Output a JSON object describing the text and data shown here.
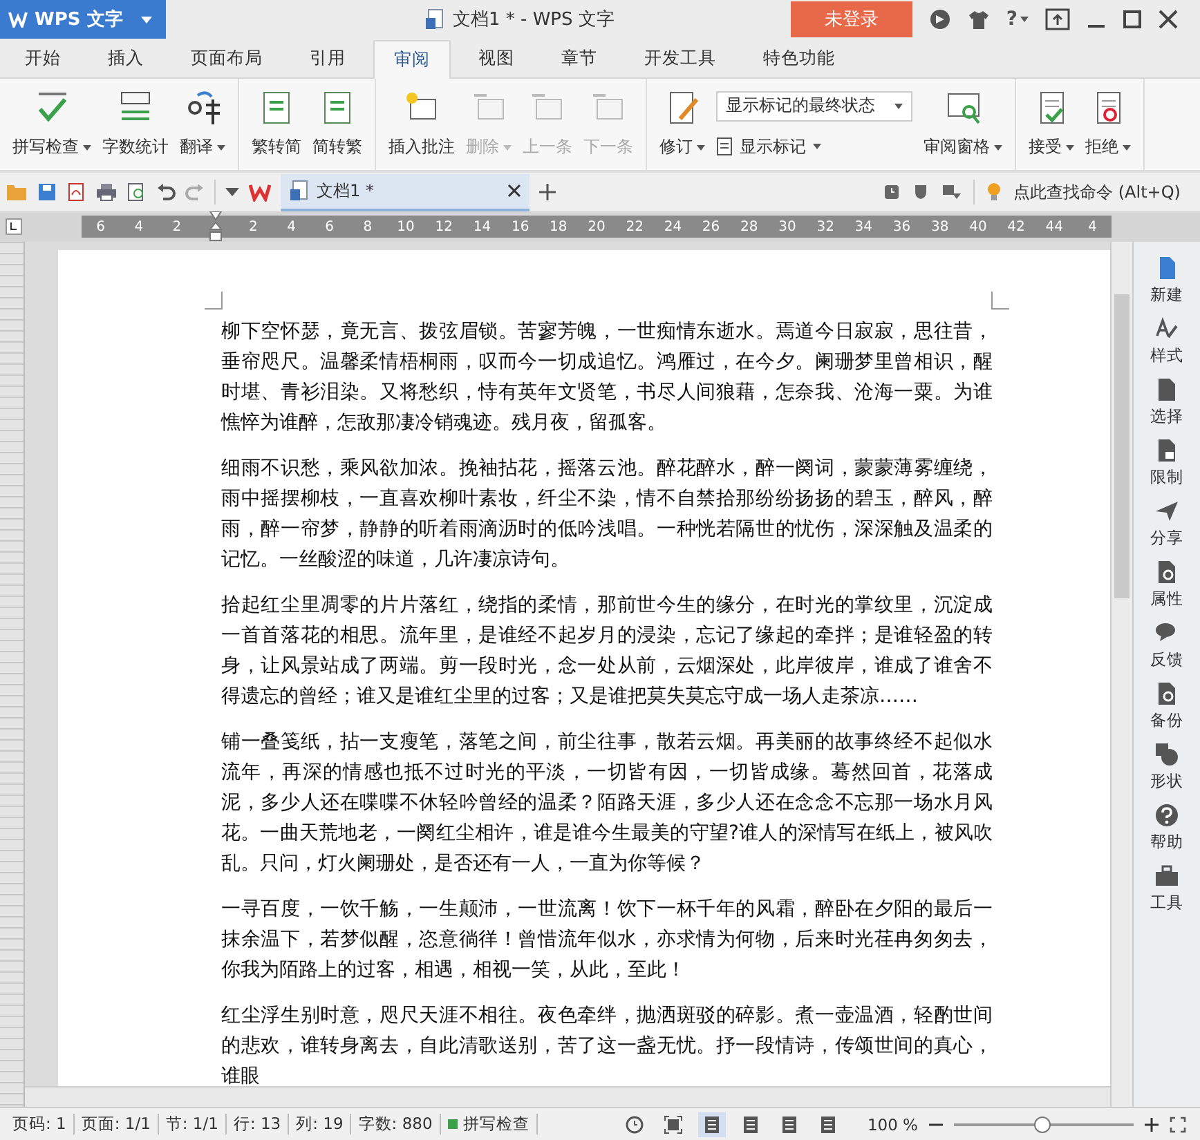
{
  "app": {
    "logo": "WPS 文字",
    "title": "文档1 * - WPS 文字",
    "login": "未登录",
    "help_glyph": "?"
  },
  "menu_tabs": [
    {
      "label": "开始",
      "selected": false
    },
    {
      "label": "插入",
      "selected": false
    },
    {
      "label": "页面布局",
      "selected": false
    },
    {
      "label": "引用",
      "selected": false
    },
    {
      "label": "审阅",
      "selected": true
    },
    {
      "label": "视图",
      "selected": false
    },
    {
      "label": "章节",
      "selected": false
    },
    {
      "label": "开发工具",
      "selected": false
    },
    {
      "label": "特色功能",
      "selected": false
    }
  ],
  "ribbon_groups": [
    {
      "items": [
        {
          "kind": "button",
          "label": "拼写检查",
          "dropdown": true,
          "disabled": false
        },
        {
          "kind": "button",
          "label": "字数统计",
          "dropdown": false,
          "disabled": false
        },
        {
          "kind": "button",
          "label": "翻译",
          "dropdown": true,
          "disabled": false
        }
      ]
    },
    {
      "items": [
        {
          "kind": "button",
          "label": "繁转简",
          "dropdown": false,
          "disabled": false
        },
        {
          "kind": "button",
          "label": "简转繁",
          "dropdown": false,
          "disabled": false
        }
      ]
    },
    {
      "items": [
        {
          "kind": "button",
          "label": "插入批注",
          "dropdown": false,
          "disabled": false
        },
        {
          "kind": "button",
          "label": "删除",
          "dropdown": true,
          "disabled": true
        },
        {
          "kind": "button",
          "label": "上一条",
          "dropdown": false,
          "disabled": true
        },
        {
          "kind": "button",
          "label": "下一条",
          "dropdown": false,
          "disabled": true
        }
      ]
    },
    {
      "items": [
        {
          "kind": "button",
          "label": "修订",
          "dropdown": true,
          "disabled": false
        },
        {
          "kind": "stack",
          "select": "显示标记的最终状态",
          "label": "显示标记",
          "dropdown": true,
          "disabled": false
        },
        {
          "kind": "button",
          "label": "审阅窗格",
          "dropdown": true,
          "disabled": false
        }
      ]
    },
    {
      "items": [
        {
          "kind": "button",
          "label": "接受",
          "dropdown": true,
          "disabled": false
        },
        {
          "kind": "button",
          "label": "拒绝",
          "dropdown": true,
          "disabled": false
        }
      ]
    }
  ],
  "doc_tab": {
    "title": "文档1 *"
  },
  "command_search": "点此查找命令 (Alt+Q)",
  "ruler_labels": [
    "6",
    "4",
    "2",
    "2",
    "4",
    "6",
    "8",
    "10",
    "12",
    "14",
    "16",
    "18",
    "20",
    "22",
    "24",
    "26",
    "28",
    "30",
    "32",
    "34",
    "36",
    "38",
    "40",
    "42",
    "44",
    "4"
  ],
  "paragraphs": [
    "柳下空怀瑟，竟无言、拨弦眉锁。苦寥芳魄，一世痴情东逝水。焉道今日寂寂，思往昔，垂帘咫尺。温馨柔情梧桐雨，叹而今一切成追忆。鸿雁过，在今夕。阑珊梦里曾相识，醒时堪、青衫泪染。又将愁织，恃有英年文贤笔，书尽人间狼藉，怎奈我、沧海一粟。为谁憔悴为谁醉，怎敌那凄冷销魂迹。残月夜，留孤客。",
    "细雨不识愁，乘风欲加浓。挽袖拈花，摇落云池。醉花醉水，醉一阕词，蒙蒙薄雾缠绕，雨中摇摆柳枝，一直喜欢柳叶素妆，纤尘不染，情不自禁拾那纷纷扬扬的碧玉，醉风，醉雨，醉一帘梦，静静的听着雨滴沥时的低吟浅唱。一种恍若隔世的忧伤，深深触及温柔的记忆。一丝酸涩的味道，几许凄凉诗句。",
    "拾起红尘里凋零的片片落红，绕指的柔情，那前世今生的缘分，在时光的掌纹里，沉淀成一首首落花的相思。流年里，是谁经不起岁月的浸染，忘记了缘起的牵拌；是谁轻盈的转身，让风景站成了两端。剪一段时光，念一处从前，云烟深处，此岸彼岸，谁成了谁舍不得遗忘的曾经；谁又是谁红尘里的过客；又是谁把莫失莫忘守成一场人走茶凉……",
    "铺一叠笺纸，拈一支瘦笔，落笔之间，前尘往事，散若云烟。再美丽的故事终经不起似水流年，再深的情感也抵不过时光的平淡，一切皆有因，一切皆成缘。蓦然回首，花落成泥，多少人还在喋喋不休轻吟曾经的温柔？陌路天涯，多少人还在念念不忘那一场水月风花。一曲天荒地老，一阕红尘相许，谁是谁今生最美的守望?谁人的深情写在纸上，被风吹乱。只问，灯火阑珊处，是否还有一人，一直为你等候？",
    "一寻百度，一饮千觞，一生颠沛，一世流离！饮下一杯千年的风霜，醉卧在夕阳的最后一抹余温下，若梦似醒，恣意徜徉！曾惜流年似水，亦求情为何物，后来时光荏冉匆匆去，你我为陌路上的过客，相遇，相视一笑，从此，至此！",
    "红尘浮生别时意，咫尺天涯不相往。夜色牵绊，抛洒斑驳的碎影。煮一壶温酒，轻酌世间的悲欢，谁转身离去，自此清歌送别，苦了这一盏无忧。抒一段情诗，传颂世间的真心，谁眼"
  ],
  "sidebar": [
    {
      "label": "新建"
    },
    {
      "label": "样式"
    },
    {
      "label": "选择"
    },
    {
      "label": "限制"
    },
    {
      "label": "分享"
    },
    {
      "label": "属性"
    },
    {
      "label": "反馈"
    },
    {
      "label": "备份"
    },
    {
      "label": "形状"
    },
    {
      "label": "帮助"
    },
    {
      "label": "工具"
    }
  ],
  "status_bar": {
    "fields": [
      "页码: 1",
      "页面: 1/1",
      "节: 1/1",
      "行: 13",
      "列: 19",
      "字数: 880"
    ],
    "spellcheck": "拼写检查",
    "views": [
      {
        "selected": false
      },
      {
        "selected": false
      },
      {
        "selected": true
      },
      {
        "selected": false
      },
      {
        "selected": false
      },
      {
        "selected": false
      }
    ],
    "zoom": "100 %",
    "zoom_slider": {
      "level": 0.49
    }
  }
}
